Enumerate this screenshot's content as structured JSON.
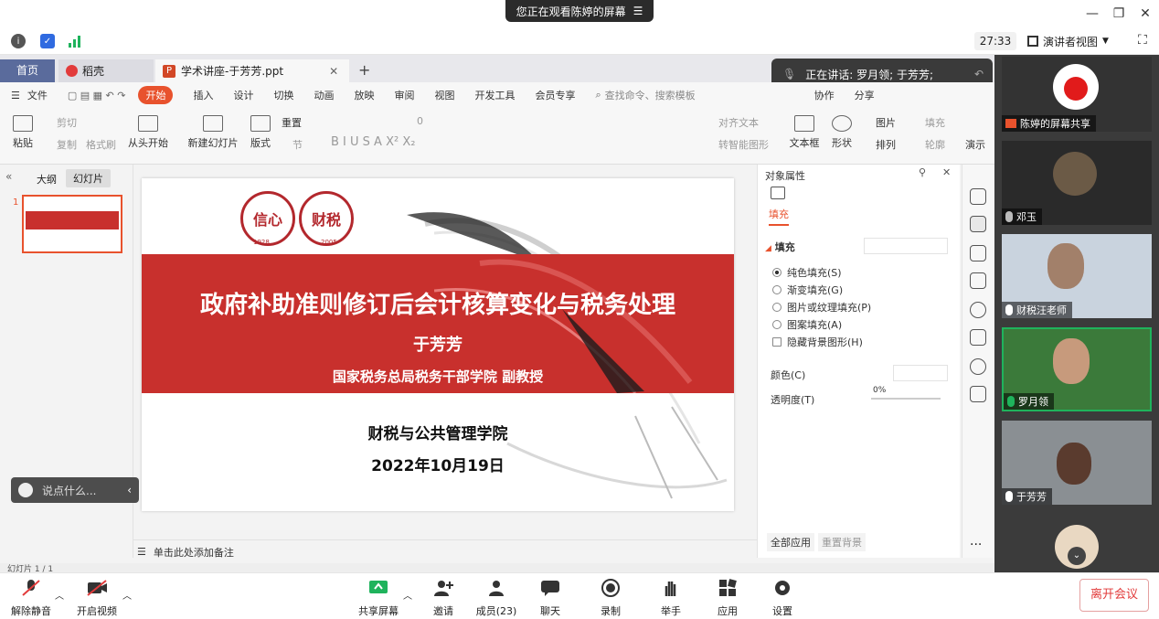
{
  "meeting": {
    "viewing_notice": "您正在观看陈婷的屏幕",
    "timer": "27:33",
    "view_mode": "演讲者视图",
    "speaking_label": "正在讲话: 罗月领; 于芳芳;"
  },
  "wps": {
    "tabs": [
      "首页",
      "稻壳",
      "学术讲座-于芳芳.ppt"
    ],
    "menu": [
      "文件",
      "开始",
      "插入",
      "设计",
      "切换",
      "动画",
      "放映",
      "审阅",
      "视图",
      "开发工具",
      "会员专享"
    ],
    "search_placeholder": "查找命令、搜索模板",
    "collab": "协作",
    "share": "分享",
    "ribbon": {
      "paste": "粘贴",
      "cut": "剪切",
      "copy": "复制",
      "format_painter": "格式刷",
      "from_start": "从头开始",
      "new_slide": "新建幻灯片",
      "layout": "版式",
      "section": "节",
      "reset": "重置",
      "font_size": "0",
      "align_text": "对齐文本",
      "smartart": "转智能图形",
      "textbox": "文本框",
      "shape": "形状",
      "picture": "图片",
      "fill": "填充",
      "arrange": "排列",
      "outline": "轮廓",
      "play": "演示"
    },
    "left_panel": {
      "outline_tab": "大纲",
      "slides_tab": "幻灯片",
      "slide_number": "1"
    },
    "notes_placeholder": "单击此处添加备注",
    "status_text": "幻灯片 1 / 1"
  },
  "slide": {
    "title": "政府补助准则修订后会计核算变化与税务处理",
    "author": "于芳芳",
    "org": "国家税务总局税务干部学院  副教授",
    "school": "财税与公共管理学院",
    "date": "2022年10月19日",
    "seal1_text": "信心",
    "seal2_text": "财税",
    "seal1_year": "1928",
    "seal2_year": "2005"
  },
  "properties": {
    "header": "对象属性",
    "fill_tab": "填充",
    "fill_section": "填充",
    "options": [
      "纯色填充(S)",
      "渐变填充(G)",
      "图片或纹理填充(P)",
      "图案填充(A)"
    ],
    "hide_bg": "隐藏背景图形(H)",
    "color_label": "颜色(C)",
    "transparency_label": "透明度(T)",
    "transparency_value": "0%",
    "apply_all": "全部应用",
    "reset_bg": "重置背景"
  },
  "chat": {
    "placeholder": "说点什么..."
  },
  "participants": [
    {
      "name": "陈婷的屏幕共享"
    },
    {
      "name": "邓玉"
    },
    {
      "name": "财税汪老师"
    },
    {
      "name": "罗月领"
    },
    {
      "name": "于芳芳"
    }
  ],
  "controls": {
    "unmute": "解除静音",
    "start_video": "开启视频",
    "share_screen": "共享屏幕",
    "invite": "邀请",
    "members": "成员(23)",
    "chat": "聊天",
    "record": "录制",
    "raise_hand": "举手",
    "apps": "应用",
    "settings": "设置",
    "leave": "离开会议"
  },
  "colors": {
    "brand_red": "#c8302d",
    "accent_orange": "#e8522d",
    "leave_red": "#e23b3b",
    "speaking_green": "#1fb35c"
  }
}
